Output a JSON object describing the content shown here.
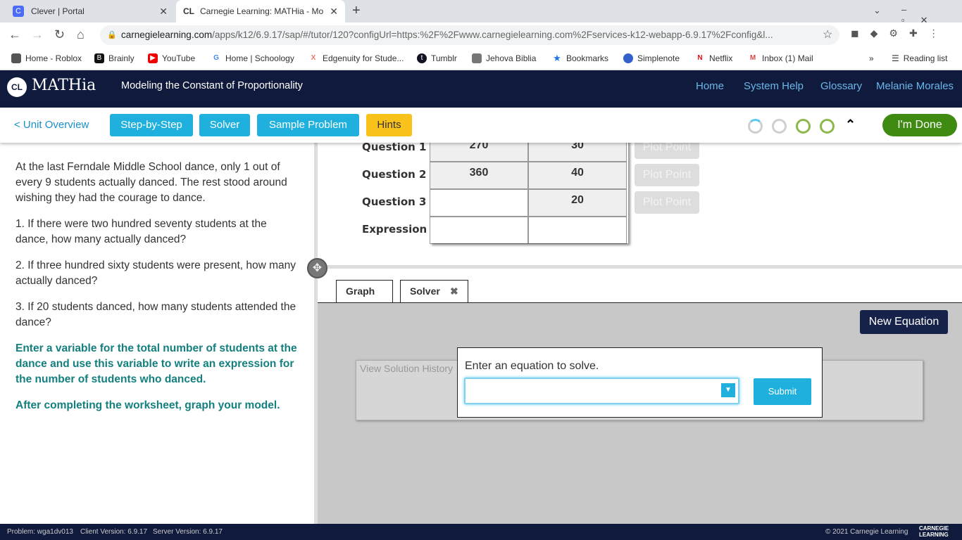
{
  "browser": {
    "tabs": [
      {
        "title": "Clever | Portal",
        "icon": "C"
      },
      {
        "title": "Carnegie Learning: MATHia - Mo",
        "icon": "CL"
      }
    ],
    "url_host": "carnegielearning.com",
    "url_path": "/apps/k12/6.9.17/sap/#/tutor/120?configUrl=https:%2F%2Fwww.carnegielearning.com%2Fservices-k12-webapp-6.9.17%2Fconfig&l...",
    "bookmarks": [
      "Home - Roblox",
      "Brainly",
      "YouTube",
      "Home | Schoology",
      "Edgenuity for Stude...",
      "Tumblr",
      "Jehova Biblia",
      "Bookmarks",
      "Simplenote",
      "Netflix",
      "Inbox (1) Mail"
    ],
    "reading_list": "Reading list"
  },
  "app": {
    "logo": "MATHia",
    "title": "Modeling the Constant of Proportionality",
    "nav": [
      "Home",
      "System Help",
      "Glossary",
      "Melanie Morales"
    ]
  },
  "toolbar": {
    "unit_overview": "< Unit Overview",
    "buttons": [
      "Step-by-Step",
      "Solver",
      "Sample Problem"
    ],
    "hints": "Hints",
    "done": "I'm Done",
    "colors": {
      "blue": "#1fb0dd",
      "hints": "#f9c21b",
      "done": "#3f8a10"
    }
  },
  "problem": {
    "intro": "At the last Ferndale Middle School dance, only 1 out of every 9 students actually danced. The rest stood around wishing they had the courage to dance.",
    "q1": "1.  If there were two hundred seventy students at the dance, how many actually danced?",
    "q2": "2.  If three hundred sixty students were present, how many actually danced?",
    "q3": "3.  If 20 students danced, how many students attended the dance?",
    "instr1": "Enter a variable for the total number of students at the dance and use this variable to write an expression for the number of students who danced.",
    "instr2": "After completing the worksheet, graph your model."
  },
  "table": {
    "rows": [
      {
        "label": "Question 1",
        "a": "270",
        "b": "30"
      },
      {
        "label": "Question 2",
        "a": "360",
        "b": "40"
      },
      {
        "label": "Question 3",
        "a": "",
        "b": "20"
      },
      {
        "label": "Expression",
        "a": "",
        "b": ""
      }
    ],
    "plot": "Plot Point"
  },
  "tools": {
    "tabs": [
      "Graph",
      "Solver"
    ],
    "new_equation": "New Equation",
    "history": "View Solution History",
    "prompt": "Enter an equation to solve.",
    "equation_value": "",
    "submit": "Submit"
  },
  "footer": {
    "problem": "Problem: wga1dv013",
    "client": "Client Version: 6.9.17",
    "server": "Server Version: 6.9.17",
    "copyright": "© 2021 Carnegie Learning",
    "logo": "CARNEGIE LEARNING"
  }
}
